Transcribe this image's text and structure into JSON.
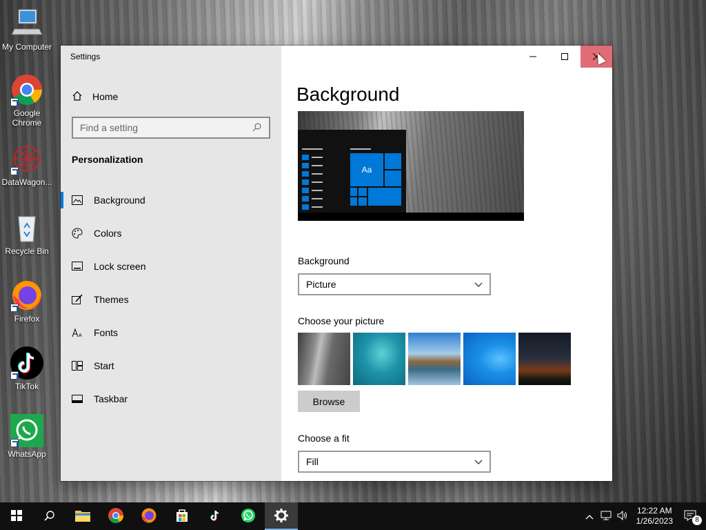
{
  "desktop": {
    "icons": [
      {
        "label": "My Computer"
      },
      {
        "label": "Google Chrome"
      },
      {
        "label": "DataWagon..."
      },
      {
        "label": "Recycle Bin"
      },
      {
        "label": "Firefox"
      },
      {
        "label": "TikTok"
      },
      {
        "label": "WhatsApp"
      }
    ]
  },
  "window": {
    "title": "Settings",
    "sidebar": {
      "home": "Home",
      "search_placeholder": "Find a setting",
      "section": "Personalization",
      "items": [
        {
          "label": "Background",
          "icon": "picture-icon",
          "active": true
        },
        {
          "label": "Colors",
          "icon": "palette-icon"
        },
        {
          "label": "Lock screen",
          "icon": "lock-screen-icon"
        },
        {
          "label": "Themes",
          "icon": "themes-icon"
        },
        {
          "label": "Fonts",
          "icon": "fonts-icon"
        },
        {
          "label": "Start",
          "icon": "start-icon"
        },
        {
          "label": "Taskbar",
          "icon": "taskbar-icon"
        }
      ]
    },
    "content": {
      "title": "Background",
      "preview_tile_text": "Aa",
      "background_label": "Background",
      "background_value": "Picture",
      "choose_picture_label": "Choose your picture",
      "browse_label": "Browse",
      "fit_label": "Choose a fit",
      "fit_value": "Fill"
    }
  },
  "taskbar": {
    "time": "12:22 AM",
    "date": "1/26/2023",
    "notification_count": "8"
  },
  "colors": {
    "accent": "#0078d7",
    "close_hover": "#e06c75"
  }
}
